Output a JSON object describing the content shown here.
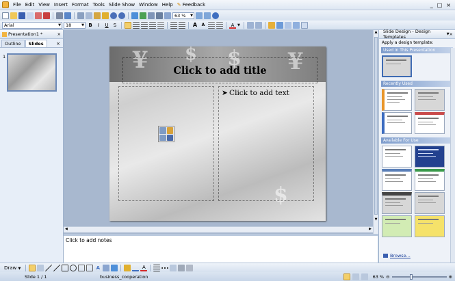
{
  "menubar": {
    "items": [
      "File",
      "Edit",
      "View",
      "Insert",
      "Format",
      "Tools",
      "Slide Show",
      "Window",
      "Help",
      "Feedback"
    ],
    "window_buttons": [
      "_",
      "□",
      "×"
    ]
  },
  "toolbar": {
    "zoom": "63 %",
    "font_name": "Arial",
    "font_size": "18",
    "bold": "B",
    "italic": "I",
    "underline": "U",
    "strike": "S",
    "font_color_letter": "A"
  },
  "left_pane": {
    "document_title": "Presentation1 *",
    "tabs": [
      "Outline",
      "Slides"
    ],
    "slide_number": "1"
  },
  "slide": {
    "title_placeholder": "Click to add title",
    "text_placeholder": "Click to add text",
    "bullet": "➤"
  },
  "notes": {
    "placeholder": "Click to add notes"
  },
  "task_pane": {
    "title": "Slide Design - Design Templates",
    "apply_label": "Apply a design template:",
    "sections": [
      "Used in This Presentation",
      "Recently Used",
      "Available For Use"
    ],
    "browse_label": "Browse..."
  },
  "drawbar": {
    "draw_label": "Draw"
  },
  "status": {
    "slide": "Slide 1 / 1",
    "design": "business_cooperation",
    "zoom": "63 %"
  }
}
